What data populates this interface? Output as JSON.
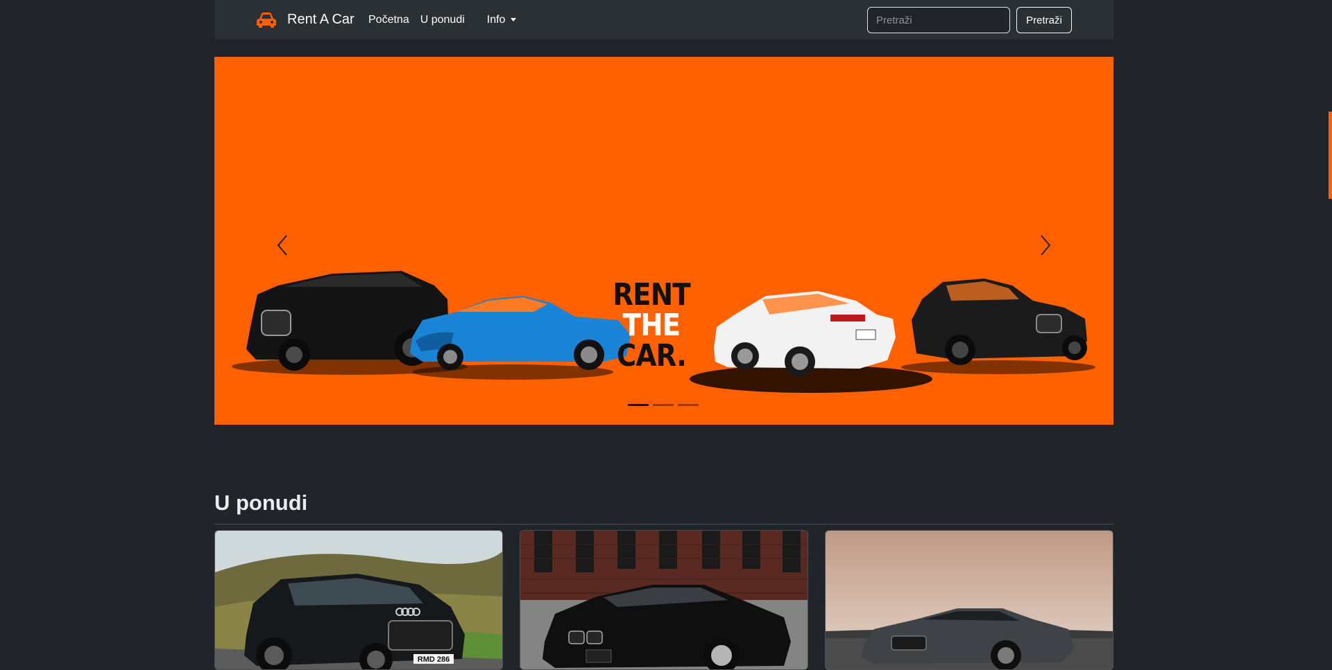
{
  "navbar": {
    "brand": "Rent A Car",
    "brand_icon": "car-icon",
    "links": [
      "Početna",
      "U ponudi"
    ],
    "dropdown_label": "Info",
    "search": {
      "placeholder": "Pretraži",
      "value": ""
    },
    "search_button": "Pretraži"
  },
  "carousel": {
    "slogan": [
      "RENT",
      "THE",
      "CAR."
    ],
    "slide_count": 3,
    "active_slide": 1,
    "prev_icon": "chevron-left-icon",
    "next_icon": "chevron-right-icon"
  },
  "section": {
    "title": "U ponudi",
    "cards": [
      {
        "image": "black-audi-wagon-photo",
        "plate": "RMD 286"
      },
      {
        "image": "black-bmw-coupe-photo"
      },
      {
        "image": "grey-audi-sportback-photo"
      }
    ]
  },
  "colors": {
    "page_bg": "#212529",
    "navbar_bg": "#2b3035",
    "accent": "#ff6000"
  }
}
